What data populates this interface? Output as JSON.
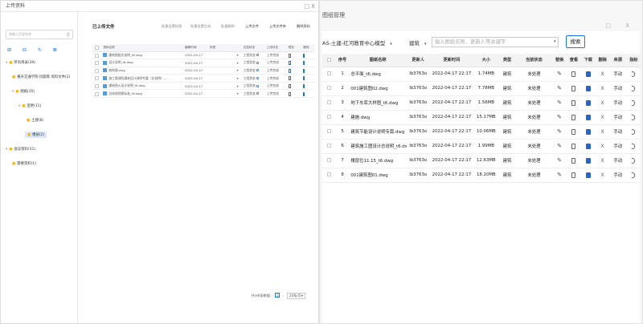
{
  "left_window": {
    "title": "上传资料",
    "close_label": "□ X",
    "search": {
      "placeholder": "请输入目录名称"
    },
    "tree_tools": "⊞ ⊟ ↻ ⊠",
    "tree": [
      {
        "label": "所有目录(39)"
      },
      {
        "label": "重庆交通学院·问题库·资料文件(2)"
      },
      {
        "label": "图纸(35)"
      },
      {
        "label": "变更(11)"
      },
      {
        "label": "土建(8)"
      },
      {
        "label": "楼层(2)"
      },
      {
        "label": "会议资料(31)"
      },
      {
        "label": "需要资料(1)"
      }
    ],
    "main": {
      "heading": "已上传文件",
      "toolbar": [
        "批量设置权限",
        "批量设置目录",
        "批量删除",
        "上传文件",
        "上传文件夹",
        "删除资料"
      ],
      "columns": [
        "资料名称",
        "编辑时间",
        "标签",
        "文档状态",
        "上传状态",
        "预览",
        "删除"
      ],
      "rows": [
        {
          "name": "建筑图纸总说明_t6.dwg",
          "date": "2022-04-17",
          "status": "工程状态",
          "upload": "上传完成"
        },
        {
          "name": "设计说明_t6.dwg",
          "date": "2022-04-17",
          "status": "工程状态",
          "upload": "上传完成"
        },
        {
          "name": "结构图.dwg",
          "date": "2022-04-17",
          "status": "工程状态",
          "upload": "上传完成"
        },
        {
          "name": "施工图消防建筑设计说明专篇（总说明）-...",
          "date": "2022-04-17",
          "status": "工程状态",
          "upload": "上传完成"
        },
        {
          "name": "建筑防火设计说明_t6.dwg",
          "date": "2022-04-17",
          "status": "工程状态",
          "upload": "上传完成"
        },
        {
          "name": "总体规划图标准_t6.dwg",
          "date": "2022-04-17",
          "status": "工程状态",
          "upload": "上传完成"
        }
      ],
      "pager": {
        "total": "共计6条数据",
        "page": "1",
        "size": "20条/页▾"
      }
    }
  },
  "right_window": {
    "title": "图纸管理",
    "close_label": "□ X",
    "filters": {
      "model": "AS-土建-红河教育中心模型",
      "major": "建筑",
      "keyword_placeholder": "输入图纸名称、更新人等关键字",
      "search_label": "搜索"
    },
    "columns": [
      "序号",
      "图纸名称",
      "更新人",
      "更新时间",
      "大小",
      "类型",
      "当前状态",
      "替换",
      "查看",
      "下载",
      "删除",
      "来源",
      "指标"
    ],
    "rows": [
      {
        "index": "1",
        "name": "总平面_t6.dwg",
        "user": "lb3763o",
        "time": "2022-04-17 22:17",
        "size": "1.74MB",
        "type": "建筑",
        "state": "未处理",
        "source": "手动"
      },
      {
        "index": "2",
        "name": "001建筑图02.dwg",
        "user": "lb3763o",
        "time": "2022-04-17 22:17",
        "size": "7.78MB",
        "type": "建筑",
        "state": "未处理",
        "source": "手动"
      },
      {
        "index": "3",
        "name": "地下车库大样图_t6.dwg",
        "user": "lb3763o",
        "time": "2022-04-17 22:17",
        "size": "1.56MB",
        "type": "建筑",
        "state": "未处理",
        "source": "手动"
      },
      {
        "index": "4",
        "name": "建施.dwg",
        "user": "lb3763o",
        "time": "2022-04-17 22:17",
        "size": "15.17MB",
        "type": "建筑",
        "state": "未处理",
        "source": "手动"
      },
      {
        "index": "5",
        "name": "建筑节能设计说明专篇.dwg",
        "user": "lb3763o",
        "time": "2022-04-17 22:17",
        "size": "10.06MB",
        "type": "建筑",
        "state": "未处理",
        "source": "手动"
      },
      {
        "index": "6",
        "name": "建筑施工图设计总说明_t6.dwg",
        "user": "lb3763o",
        "time": "2022-04-17 22:17",
        "size": "1.99MB",
        "type": "建筑",
        "state": "未处理",
        "source": "手动"
      },
      {
        "index": "7",
        "name": "楼层位11.15_t6.dwg",
        "user": "lb3763o",
        "time": "2022-04-17 22:17",
        "size": "12.63MB",
        "type": "建筑",
        "state": "未处理",
        "source": "手动"
      },
      {
        "index": "8",
        "name": "001建筑图01.dwg",
        "user": "lb3763o",
        "time": "2022-04-17 22:17",
        "size": "18.20MB",
        "type": "建筑",
        "state": "未处理",
        "source": "手动"
      }
    ]
  }
}
